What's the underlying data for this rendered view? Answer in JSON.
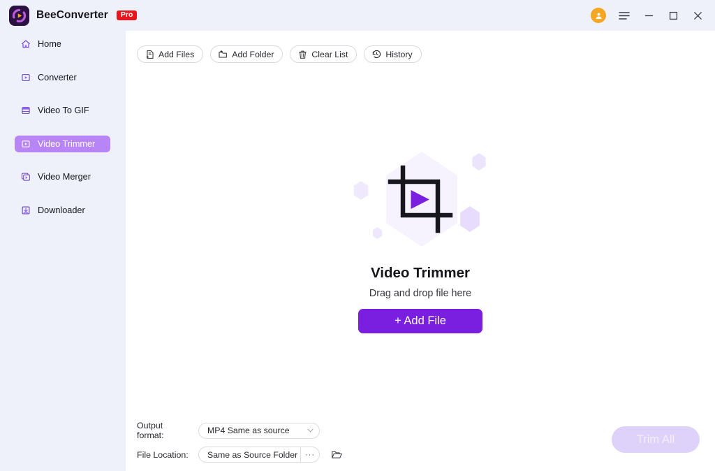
{
  "titlebar": {
    "app_name": "BeeConverter",
    "pro_badge": "Pro",
    "logo_icon": "bee-converter-logo",
    "avatar_icon": "user-avatar-icon",
    "menu_icon": "hamburger-menu-icon",
    "minimize_icon": "minimize-icon",
    "maximize_icon": "maximize-icon",
    "close_icon": "close-icon",
    "accent_color": "#7a1fe0",
    "badge_color": "#e8161d",
    "avatar_color": "#f5a623",
    "bar_color": "#eef1fa"
  },
  "sidebar": {
    "background": "#eef1fa",
    "active_color": "#b885f7",
    "items": [
      {
        "label": "Home",
        "icon": "home-icon",
        "active": false
      },
      {
        "label": "Converter",
        "icon": "converter-icon",
        "active": false
      },
      {
        "label": "Video To GIF",
        "icon": "video-to-gif-icon",
        "active": false
      },
      {
        "label": "Video Trimmer",
        "icon": "video-trimmer-icon",
        "active": true
      },
      {
        "label": "Video Merger",
        "icon": "video-merger-icon",
        "active": false
      },
      {
        "label": "Downloader",
        "icon": "downloader-icon",
        "active": false
      }
    ]
  },
  "toolbar": {
    "buttons": [
      {
        "label": "Add Files",
        "icon": "add-files-icon"
      },
      {
        "label": "Add Folder",
        "icon": "add-folder-icon"
      },
      {
        "label": "Clear List",
        "icon": "trash-icon"
      },
      {
        "label": "History",
        "icon": "history-clock-icon"
      }
    ]
  },
  "dropzone": {
    "illustration_icon": "video-crop-trim-illustration",
    "title": "Video Trimmer",
    "subtitle": "Drag and drop file here",
    "add_file_label": "+ Add File",
    "button_color": "#7a1fe0"
  },
  "footer": {
    "output_format_label": "Output format:",
    "output_format_value": "MP4 Same as source",
    "file_location_label": "File Location:",
    "file_location_value": "Same as Source Folder",
    "browse_dots": "···",
    "folder_icon": "open-folder-icon",
    "chevron_icon": "chevron-down-icon",
    "trim_all_label": "Trim All",
    "trim_all_disabled_color": "#ded2fa"
  }
}
